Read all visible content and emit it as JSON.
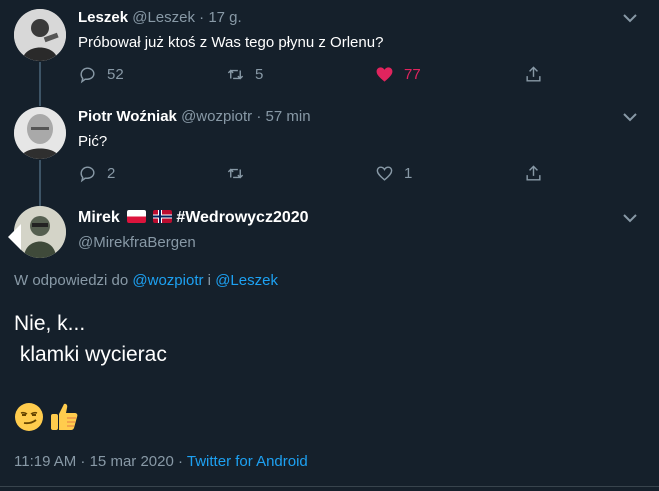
{
  "tweet1": {
    "name": "Leszek",
    "handle": "@Leszek",
    "separator": "·",
    "time": "17 g.",
    "text": "Próbował już ktoś z Was tego płynu z Orlenu?",
    "replies": "52",
    "retweets": "5",
    "likes": "77",
    "liked": true
  },
  "tweet2": {
    "name": "Piotr Woźniak",
    "handle": "@wozpiotr",
    "separator": "·",
    "time": "57 min",
    "text": "Pić?",
    "replies": "2",
    "retweets": "",
    "likes": "1"
  },
  "main": {
    "name": "Mirek",
    "hashtag": "#Wedrowycz2020",
    "handle": "@MirekfraBergen",
    "reply_prefix": "W odpowiedzi do",
    "reply_user1": "@wozpiotr",
    "reply_conj": "i",
    "reply_user2": "@Leszek",
    "line1": "Nie, k...",
    "line2": " klamki wycierac",
    "emoji": [
      "smirk-emoji",
      "thumbs-up-emoji"
    ],
    "timestamp": "11:19 AM · 15 mar 2020 ·",
    "source": "Twitter for Android"
  },
  "colors": {
    "background": "#15202b",
    "muted": "#8899a6",
    "link": "#1da1f2",
    "like": "#e0245e",
    "divider": "#38444d"
  }
}
